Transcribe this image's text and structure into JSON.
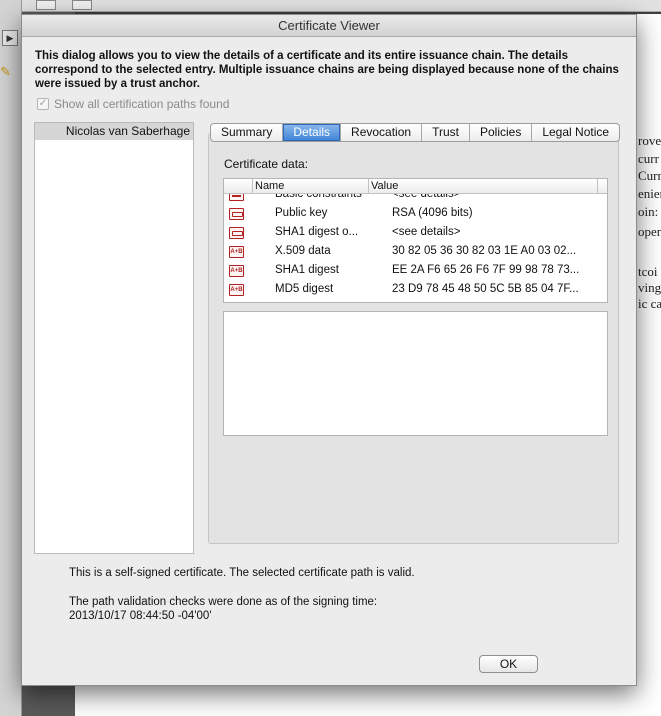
{
  "dialog": {
    "title": "Certificate Viewer",
    "intro": "This dialog allows you to view the details of a certificate and its entire issuance chain. The details correspond to the selected entry. Multiple issuance chains are being displayed because none of the chains were issued by a trust anchor.",
    "show_all_label": "Show all certification paths found",
    "show_all_checked": true
  },
  "chain": {
    "items": [
      {
        "label": "Nicolas van Saberhage",
        "selected": true
      }
    ]
  },
  "tabs": [
    {
      "label": "Summary",
      "active": false
    },
    {
      "label": "Details",
      "active": true
    },
    {
      "label": "Revocation",
      "active": false
    },
    {
      "label": "Trust",
      "active": false
    },
    {
      "label": "Policies",
      "active": false
    },
    {
      "label": "Legal Notice",
      "active": false
    }
  ],
  "details": {
    "certificate_data_label": "Certificate data:",
    "columns": {
      "name": "Name",
      "value": "Value"
    },
    "rows": [
      {
        "icon": "extension-icon",
        "name": "Basic constraints",
        "value": "<see details>"
      },
      {
        "icon": "key-icon",
        "name": "Public key",
        "value": "RSA (4096 bits)"
      },
      {
        "icon": "key-icon",
        "name": "SHA1 digest o...",
        "value": "<see details>"
      },
      {
        "icon": "data-icon",
        "name": "X.509 data",
        "value": "30 82 05 36 30 82 03 1E A0 03 02..."
      },
      {
        "icon": "data-icon",
        "name": "SHA1 digest",
        "value": "EE 2A F6 65 26 F6 7F 99 98 78 73..."
      },
      {
        "icon": "data-icon",
        "name": "MD5 digest",
        "value": "23 D9 78 45 48 50 5C 5B 85 04 7F..."
      }
    ]
  },
  "status": {
    "self_signed": "This is a self-signed certificate. The selected certificate path is valid.",
    "validation_line1": "The path validation checks were done as of the signing time:",
    "validation_line2": "2013/10/17 08:44:50 -04'00'"
  },
  "buttons": {
    "ok_label": "OK"
  },
  "background": {
    "right_text": [
      "rove",
      "curr",
      "Curre",
      "enien",
      "oin:",
      "open",
      "",
      "tcoi",
      "ving",
      "ic ca"
    ]
  }
}
